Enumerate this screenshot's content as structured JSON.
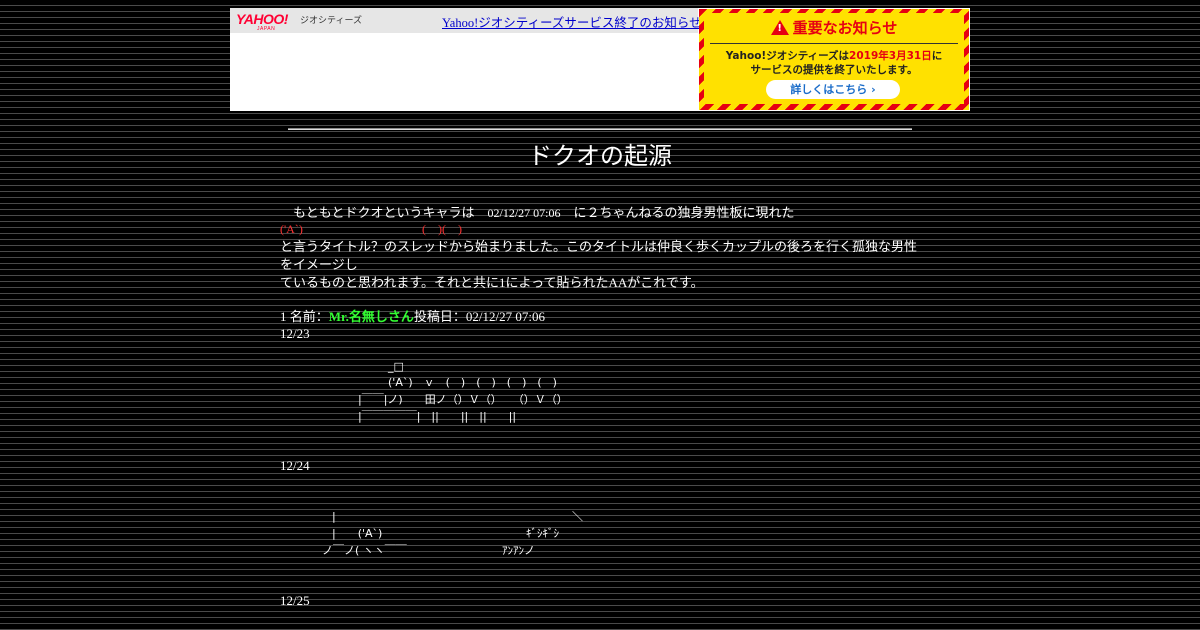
{
  "banner": {
    "logo": "YAHOO!",
    "logo_sub": "JAPAN",
    "geo_label": "ジオシティーズ",
    "link_text": "Yahoo!ジオシティーズサービス終了のお知らせ",
    "notice": {
      "heading": "重要なお知らせ",
      "body_line1_pre": "Yahoo!ジオシティーズは",
      "body_line1_date": "2019年3月31日",
      "body_line1_post": "に",
      "body_line2": "サービスの提供を終了いたします。",
      "button": "詳しくはこちら ›"
    }
  },
  "page": {
    "title": "ドクオの起源",
    "intro_line1_a": "　もともとドクオというキャラは　",
    "intro_line1_date": "02/12/27 07:06",
    "intro_line1_b": "　に２ちゃんねるの独身男性板に現れた",
    "intro_thread_title_a": "('A`)",
    "intro_thread_title_b": "(　)(　)",
    "intro_line3": "と言うタイトル？のスレッドから始まりました。このタイトルは仲良く歩くカップルの後ろを行く孤独な男性",
    "intro_line4": "をイメージし",
    "intro_line5": "ているものと思われます。それと共に1によって貼られたAAがこれです。",
    "post_num": "1",
    "post_name_label": "名前：",
    "post_name": "Mr.名無しさん",
    "post_date_label": "投稿日：",
    "post_date": "02/12/27 07:06",
    "date1": "12/23",
    "aa1": {
      "l1": "_□",
      "l2": "('A`)　ｖ　(　)　(　)　(　)　(　)",
      "l3": "|￣￣|ノ)　　田ノ（）Ｖ（）　　（）Ｖ（）",
      "l4": "|￣￣￣￣￣|　||　　||　||　　||"
    },
    "date2": "12/24",
    "aa2": {
      "l1": "|",
      "l1b": "＼",
      "l2": "|　　('A`)",
      "l2b": "ｷﾞｼｷﾞｼ",
      "l3": "ノ￣ノ( ヽヽ￣￣",
      "l3b": "ｱﾝｱﾝノ"
    },
    "date3": "12/25"
  }
}
